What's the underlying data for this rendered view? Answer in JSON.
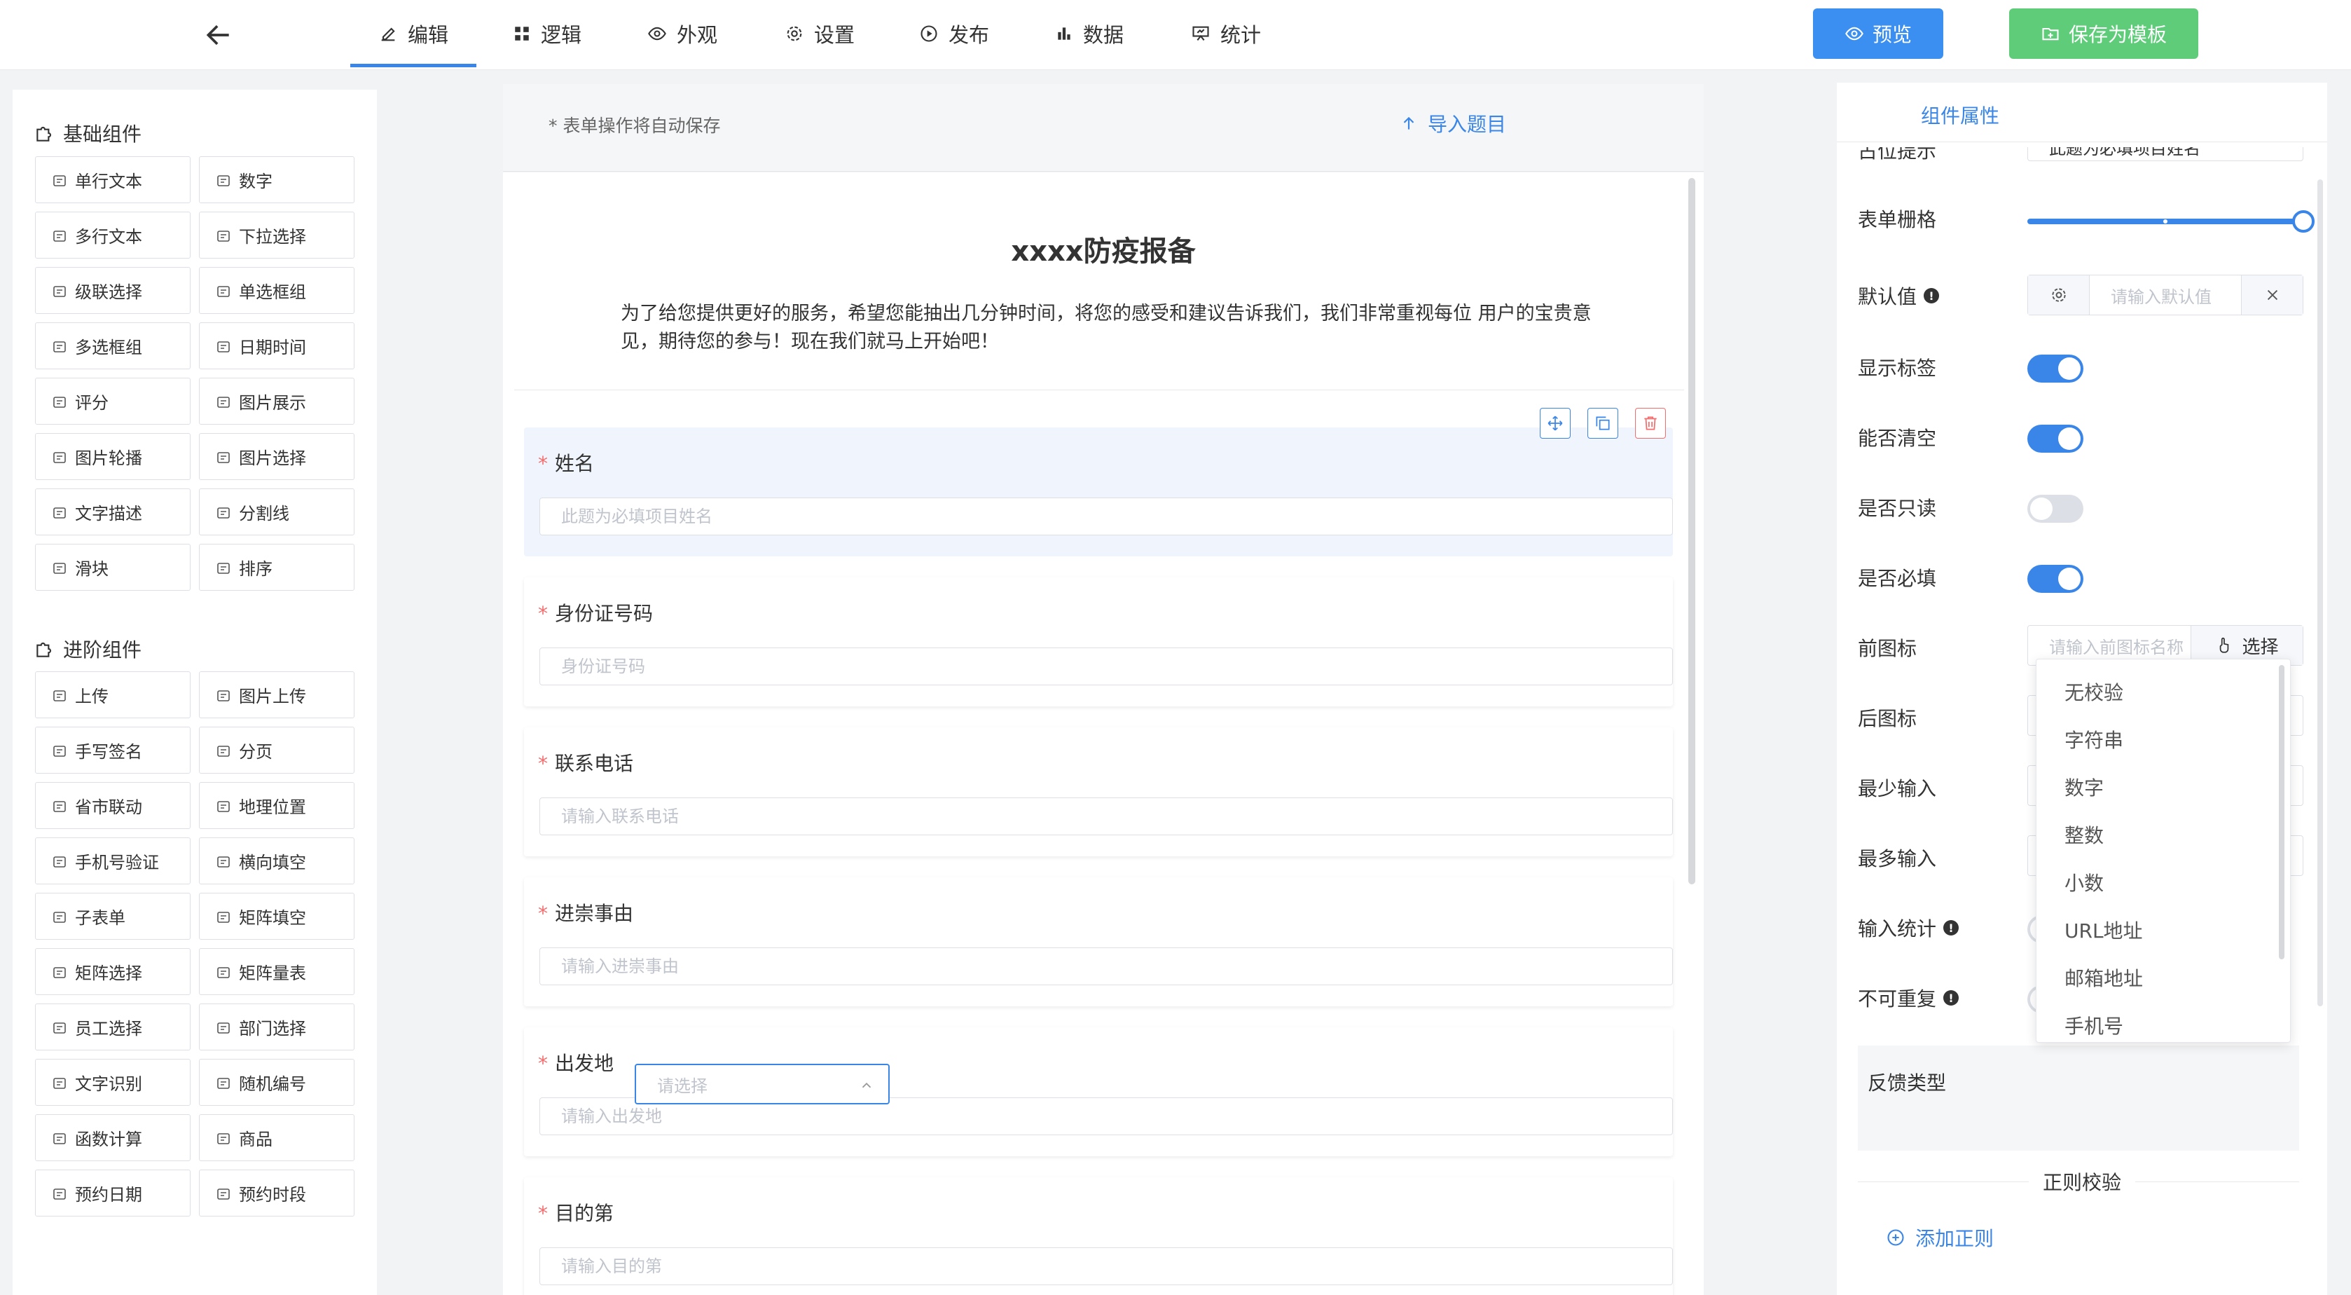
{
  "topbar": {
    "tabs": [
      {
        "label": "编辑",
        "icon": "edit-icon",
        "active": true
      },
      {
        "label": "逻辑",
        "icon": "grid-icon"
      },
      {
        "label": "外观",
        "icon": "eye-icon"
      },
      {
        "label": "设置",
        "icon": "gear-icon"
      },
      {
        "label": "发布",
        "icon": "play-icon"
      },
      {
        "label": "数据",
        "icon": "bar-chart-icon"
      },
      {
        "label": "统计",
        "icon": "presentation-icon"
      }
    ],
    "preview_label": "预览",
    "save_template_label": "保存为模板"
  },
  "left_panel": {
    "basic_title": "基础组件",
    "basic_items": [
      "单行文本",
      "数字",
      "多行文本",
      "下拉选择",
      "级联选择",
      "单选框组",
      "多选框组",
      "日期时间",
      "评分",
      "图片展示",
      "图片轮播",
      "图片选择",
      "文字描述",
      "分割线",
      "滑块",
      "排序"
    ],
    "advanced_title": "进阶组件",
    "advanced_items": [
      "上传",
      "图片上传",
      "手写签名",
      "分页",
      "省市联动",
      "地理位置",
      "手机号验证",
      "横向填空",
      "子表单",
      "矩阵填空",
      "矩阵选择",
      "矩阵量表",
      "员工选择",
      "部门选择",
      "文字识别",
      "随机编号",
      "函数计算",
      "商品",
      "预约日期",
      "预约时段"
    ]
  },
  "canvas": {
    "autosave_note": "* 表单操作将自动保存",
    "import_label": "导入题目",
    "form_title": "xxxx防疫报备",
    "form_desc": "为了给您提供更好的服务，希望您能抽出几分钟时间，将您的感受和建议告诉我们，我们非常重视每位 用户的宝贵意见，期待您的参与！现在我们就马上开始吧！",
    "fields": [
      {
        "label": "姓名",
        "placeholder": "此题为必填项目姓名",
        "required": true
      },
      {
        "label": "身份证号码",
        "placeholder": "身份证号码",
        "required": true
      },
      {
        "label": "联系电话",
        "placeholder": "请输入联系电话",
        "required": true
      },
      {
        "label": "进崇事由",
        "placeholder": "请输入进崇事由",
        "required": true
      },
      {
        "label": "出发地",
        "placeholder": "请输入出发地",
        "required": true
      },
      {
        "label": "目的第",
        "placeholder": "请输入目的第",
        "required": true
      }
    ]
  },
  "right_panel": {
    "tab_label": "组件属性",
    "placeholder_label": "占位提示",
    "placeholder_value": "此题为必填项目姓名",
    "grid_label": "表单栅格",
    "grid_value": 1.0,
    "default_label": "默认值",
    "default_placeholder": "请输入默认值",
    "show_label_label": "显示标签",
    "show_label_on": true,
    "clearable_label": "能否清空",
    "clearable_on": true,
    "readonly_label": "是否只读",
    "readonly_on": false,
    "required_label": "是否必填",
    "required_on": true,
    "prefix_icon_label": "前图标",
    "prefix_icon_placeholder": "请输入前图标名称",
    "choose_label": "选择",
    "suffix_icon_label": "后图标",
    "min_input_label": "最少输入",
    "max_input_label": "最多输入",
    "input_count_label": "输入统计",
    "no_repeat_label": "不可重复",
    "feedback_label": "反馈类型",
    "feedback_placeholder": "请选择",
    "dropdown_options": [
      "无校验",
      "字符串",
      "数字",
      "整数",
      "小数",
      "URL地址",
      "邮箱地址",
      "手机号"
    ],
    "regex_section_title": "正则校验",
    "add_rule_label": "添加正则"
  },
  "colors": {
    "primary": "#3a86e8",
    "success_button": "#5fcc7a",
    "danger": "#f56c6c"
  }
}
